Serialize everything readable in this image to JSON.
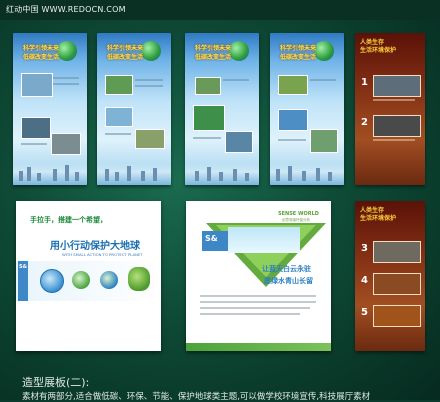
{
  "watermark": "红动中国 WWW.REDOCN.COM",
  "blue_panels": {
    "title_line1": "科学引领未来",
    "title_line2": "低碳改变生活"
  },
  "brown_panels": {
    "title_line1": "人类生存",
    "title_line2": "生活环境保护",
    "top_numbers": [
      "1",
      "2"
    ],
    "bottom_numbers": [
      "3",
      "4",
      "5"
    ]
  },
  "board_left": {
    "line1": "手拉手，搭建一个希望，",
    "line2": "用小行动保护大地球",
    "line3": "WITH SMALL ACTION TO PROTECT PLANET"
  },
  "board_right": {
    "brand": "SENSE WORLD",
    "brand_sub": "创意低碳环保分析",
    "logo_text": "S&",
    "caption1": "让蓝天白云永驻",
    "caption2": "愿绿水青山长留"
  },
  "caption": {
    "line1": "造型展板(二):",
    "line2": "素材有两部分,适合做低碳、环保、节能、保护地球类主题,可以做学校环境宣传,科技展厅素材"
  }
}
